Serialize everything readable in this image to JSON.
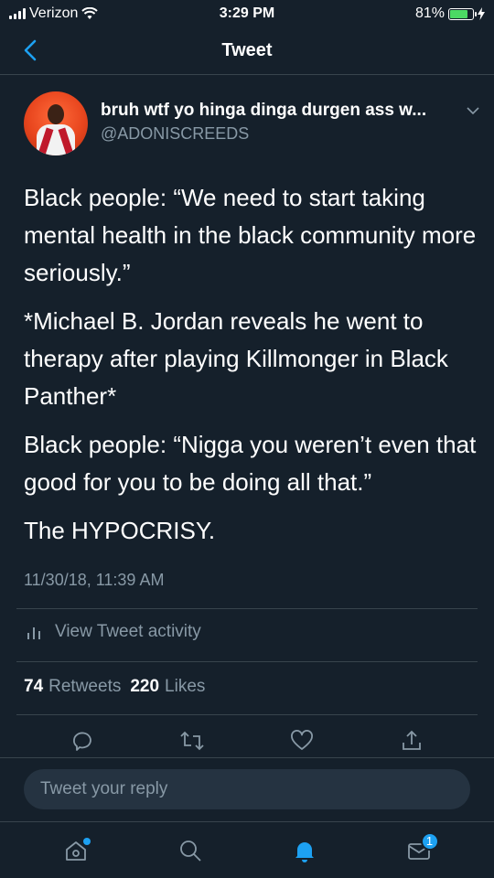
{
  "status_bar": {
    "carrier": "Verizon",
    "time": "3:29 PM",
    "battery": "81%",
    "battery_level": 0.81
  },
  "nav": {
    "title": "Tweet",
    "back_icon": "chevron-left-icon"
  },
  "tweet": {
    "display_name": "bruh wtf yo hinga dinga durgen ass w...",
    "handle": "@ADONISCREEDS",
    "paragraphs": [
      "Black people: “We need to start taking mental health in the black community more seriously.”",
      "*Michael B. Jordan reveals he went to therapy after playing Killmonger in Black Panther*",
      "Black people: “Nigga you weren’t even that good for you to be doing all that.”",
      "The HYPOCRISY."
    ],
    "timestamp": "11/30/18, 11:39 AM",
    "activity_label": "View Tweet activity",
    "retweets_count": "74",
    "retweets_label": "Retweets",
    "likes_count": "220",
    "likes_label": "Likes"
  },
  "reply": {
    "placeholder": "Tweet your reply"
  },
  "tabbar": {
    "messages_badge": "1"
  },
  "colors": {
    "background": "#15202b",
    "accent": "#1da1f2",
    "muted": "#8899a6",
    "divider": "#38444d"
  }
}
